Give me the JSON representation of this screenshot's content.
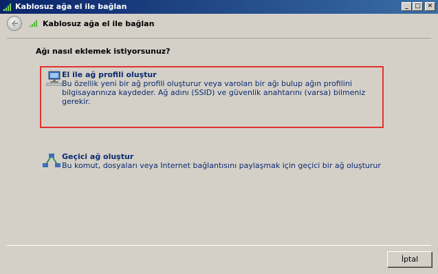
{
  "window": {
    "title": "Kablosuz ağa el ile bağlan",
    "controls": {
      "minimize": "_",
      "maximize": "□",
      "close": "✕"
    },
    "icon": "wireless-signal-icon"
  },
  "navbar": {
    "back_icon": "back-arrow-icon",
    "title_icon": "wireless-signal-icon",
    "title": "Kablosuz ağa el ile bağlan"
  },
  "main": {
    "question": "Ağı nasıl eklemek istiyorsunuz?",
    "options": [
      {
        "icon": "network-computer-icon",
        "title": "El ile ağ profili oluştur",
        "description": "Bu özellik yeni bir ağ profili oluşturur veya varolan bir ağı bulup ağın profilini bilgisayarınıza kaydeder. Ağ adını (SSID) ve güvenlik anahtarını (varsa) bilmeniz gerekir.",
        "highlighted": true,
        "highlight_color": "#e2312d"
      },
      {
        "icon": "adhoc-network-icon",
        "title": "Geçici ağ oluştur",
        "description": "Bu komut, dosyaları veya Internet bağlantısını paylaşmak için geçici bir ağ oluşturur"
      }
    ]
  },
  "footer": {
    "cancel_label": "İptal"
  },
  "colors": {
    "titlebar": "#0a246a",
    "link_text": "#0b2a6f",
    "highlight": "#e2312d",
    "background": "#d4d0c8"
  }
}
